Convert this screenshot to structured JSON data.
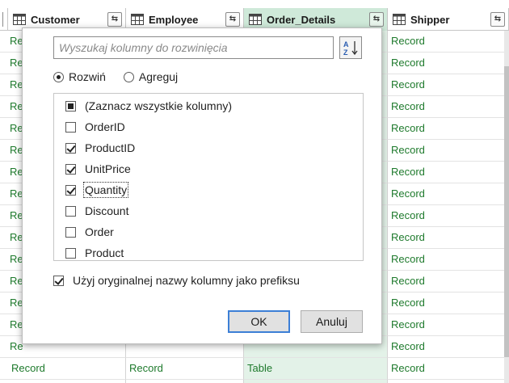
{
  "columns": [
    {
      "name": "",
      "selected": false
    },
    {
      "name": "Customer",
      "selected": false
    },
    {
      "name": "Employee",
      "selected": false
    },
    {
      "name": "Order_Details",
      "selected": true
    },
    {
      "name": "Shipper",
      "selected": false
    }
  ],
  "expand_icon": "⇆",
  "rows": [
    [
      "Re",
      "",
      "",
      "",
      "Record"
    ],
    [
      "Re",
      "",
      "",
      "",
      "Record"
    ],
    [
      "Re",
      "",
      "",
      "",
      "Record"
    ],
    [
      "Re",
      "",
      "",
      "",
      "Record"
    ],
    [
      "Re",
      "",
      "",
      "",
      "Record"
    ],
    [
      "Re",
      "",
      "",
      "",
      "Record"
    ],
    [
      "Re",
      "",
      "",
      "",
      "Record"
    ],
    [
      "Re",
      "",
      "",
      "",
      "Record"
    ],
    [
      "Re",
      "",
      "",
      "",
      "Record"
    ],
    [
      "Re",
      "",
      "",
      "",
      "Record"
    ],
    [
      "Re",
      "",
      "",
      "",
      "Record"
    ],
    [
      "Re",
      "",
      "",
      "",
      "Record"
    ],
    [
      "Re",
      "",
      "",
      "",
      "Record"
    ],
    [
      "Re",
      "",
      "",
      "",
      "Record"
    ],
    [
      "Re",
      "",
      "",
      "",
      "Record"
    ],
    [
      "",
      "Record",
      "Record",
      "Table",
      "Record"
    ],
    [
      "",
      "Record",
      "Record",
      "Table",
      "Record"
    ]
  ],
  "dialog": {
    "search_placeholder": "Wyszukaj kolumny do rozwinięcia",
    "sort_icon": "sort-az-icon",
    "radio_expand": "Rozwiń",
    "radio_aggregate": "Agreguj",
    "items": [
      {
        "label": "(Zaznacz wszystkie kolumny)",
        "state": "tri"
      },
      {
        "label": "OrderID",
        "state": "off"
      },
      {
        "label": "ProductID",
        "state": "on"
      },
      {
        "label": "UnitPrice",
        "state": "on"
      },
      {
        "label": "Quantity",
        "state": "on"
      },
      {
        "label": "Discount",
        "state": "off"
      },
      {
        "label": "Order",
        "state": "off"
      },
      {
        "label": "Product",
        "state": "off"
      }
    ],
    "prefix_label": "Użyj oryginalnej nazwy kolumny jako prefiksu",
    "ok_label": "OK",
    "cancel_label": "Anuluj"
  },
  "colors": {
    "selected_header": "#cfe9d9",
    "selected_cell": "#e3f2e8",
    "cell_text": "#1e7a2c",
    "ok_border": "#3c7fd6"
  }
}
